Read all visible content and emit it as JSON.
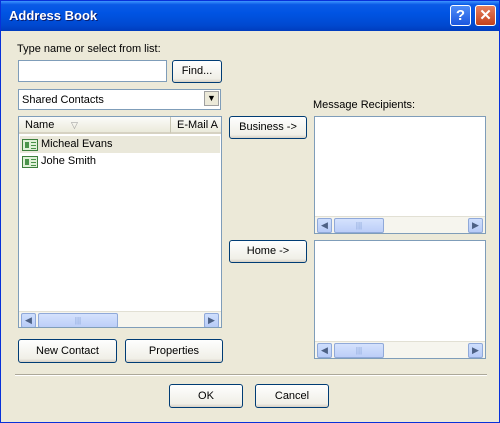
{
  "window": {
    "title": "Address Book",
    "help_label": "?",
    "close_label": "✕"
  },
  "search": {
    "label": "Type name or select from list:",
    "value": "",
    "find_label": "Find..."
  },
  "source": {
    "selected": "Shared Contacts"
  },
  "contacts": {
    "columns": [
      "Name",
      "E-Mail A"
    ],
    "sort_glyph": "▽",
    "rows": [
      {
        "name": "Micheal Evans",
        "selected": true
      },
      {
        "name": "Johe Smith",
        "selected": false
      }
    ]
  },
  "actions": {
    "business_label": "Business ->",
    "home_label": "Home ->"
  },
  "recipients": {
    "label": "Message Recipients:"
  },
  "bottom": {
    "new_contact_label": "New Contact",
    "properties_label": "Properties"
  },
  "dialog": {
    "ok_label": "OK",
    "cancel_label": "Cancel"
  },
  "scrollbar": {
    "left_glyph": "◀",
    "right_glyph": "▶",
    "grip_glyph": "|||"
  }
}
